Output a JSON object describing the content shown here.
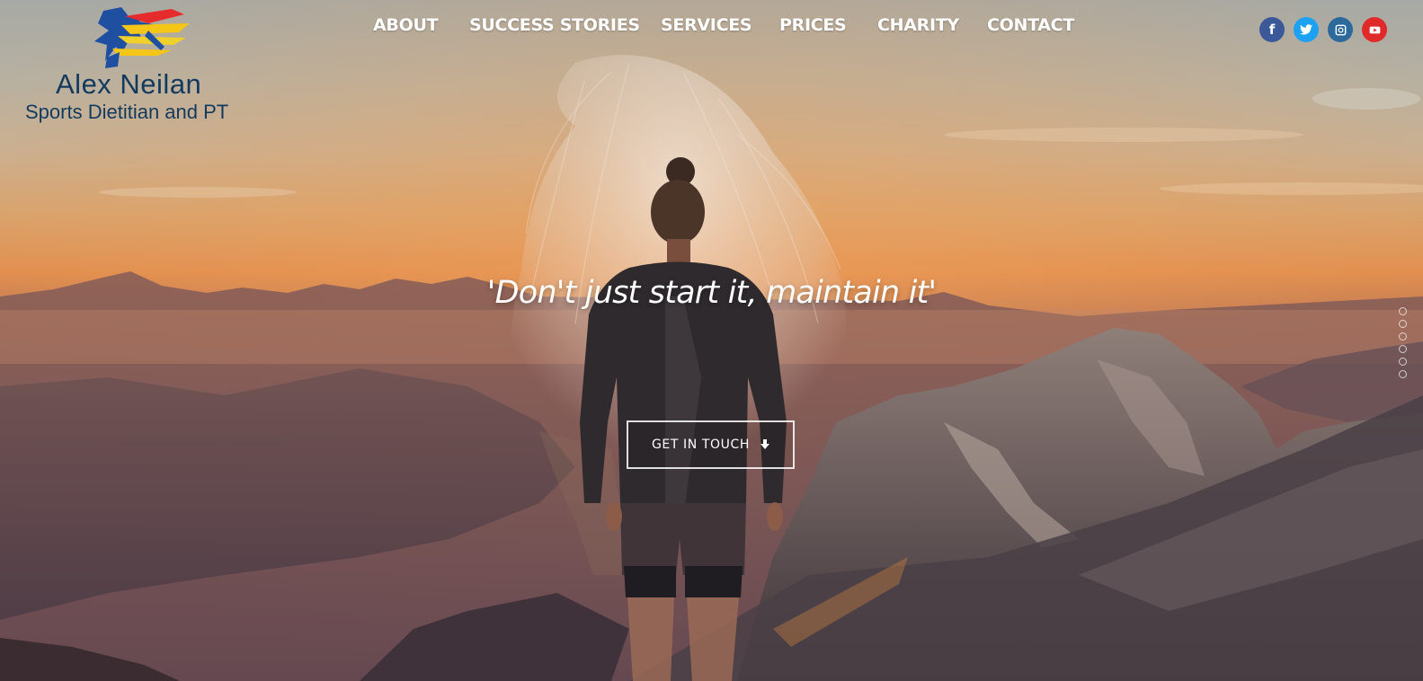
{
  "brand": {
    "name": "Alex Neilan",
    "tagline": "Sports Dietitian and PT"
  },
  "nav": {
    "items": [
      "ABOUT",
      "SUCCESS STORIES",
      "SERVICES",
      "PRICES",
      "CHARITY",
      "CONTACT"
    ]
  },
  "social": {
    "facebook": "f",
    "twitter_icon": "twitter-icon",
    "instagram_icon": "instagram-icon",
    "youtube_icon": "youtube-icon",
    "colors": {
      "facebook": "#3b5998",
      "twitter": "#1da1f2",
      "instagram": "#2b6a9b",
      "youtube": "#e02a2a"
    }
  },
  "hero": {
    "quote": "'Don't just start it, maintain it'",
    "cta_label": "GET IN TOUCH",
    "cta_icon": "arrow-down-icon",
    "slide_dots": 6
  }
}
